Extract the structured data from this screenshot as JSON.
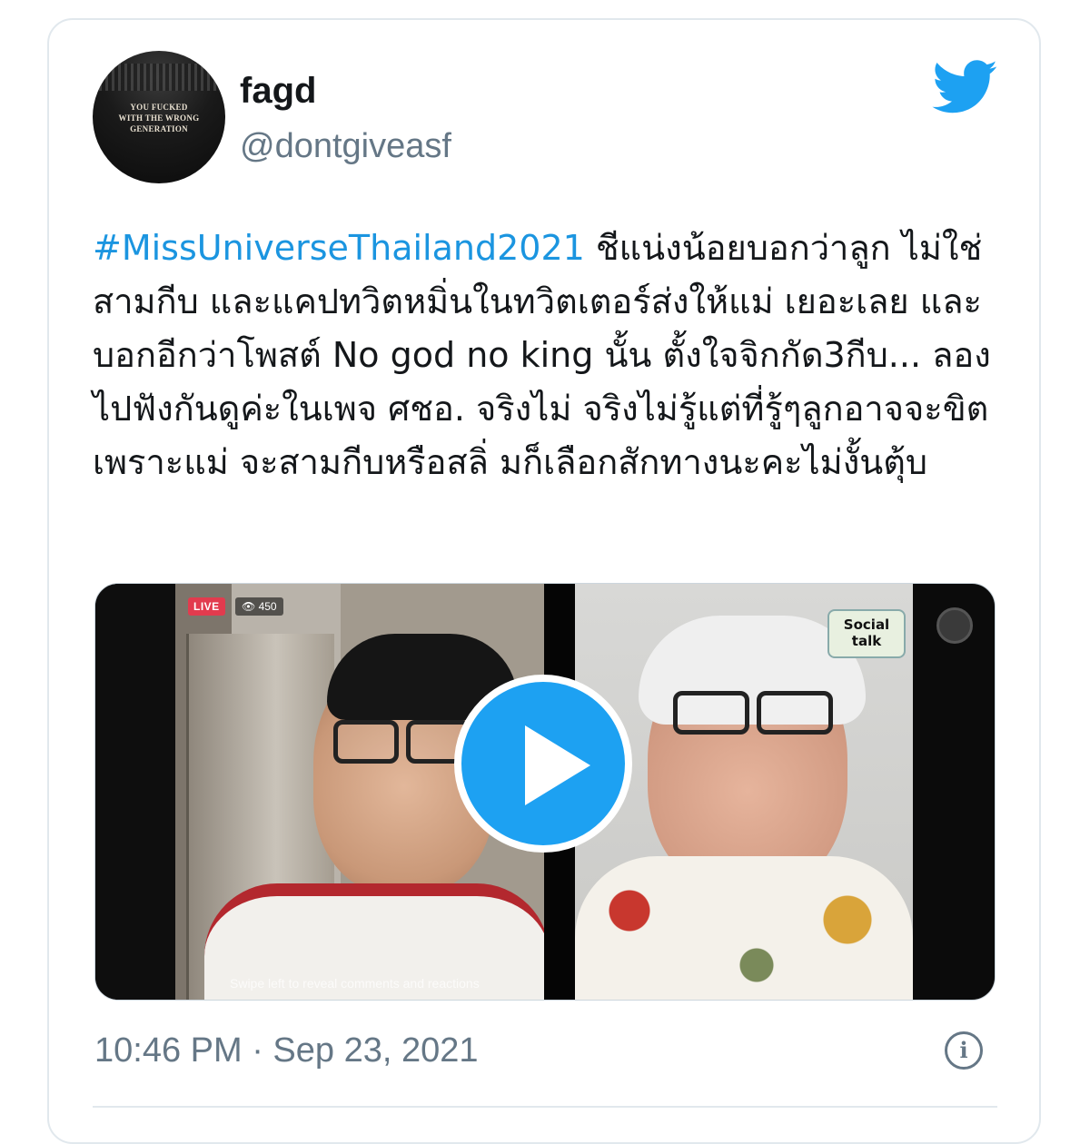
{
  "author": {
    "display_name": "fagd",
    "handle": "@dontgiveasf",
    "avatar_text": "YOU FUCKED\nWITH THE WRONG\nGENERATION"
  },
  "tweet": {
    "hashtag": "#MissUniverseThailand2021",
    "body": " ชีแน่งน้อยบอกว่าลูก ไม่ใช่สามกีบ และแคปทวิตหมิ่นในทวิตเตอร์ส่งให้แม่ เยอะเลย และบอกอีกว่าโพสต์ No god no king นั้น ตั้งใจจิกกัด3กีบ... ลองไปฟังกันดูค่ะในเพจ ศชอ. จริงไม่ จริงไม่รู้แต่ที่รู้ๆลูกอาจจะขิตเพราะแม่ จะสามกีบหรือสลิ่ มก็เลือกสักทางนะคะไม่งั้นตุ้บ"
  },
  "media": {
    "live_label": "LIVE",
    "viewers_count": "👁 450",
    "social_logo_text": "Social talk",
    "overlay_caption": "Swipe left to reveal comments and reactions"
  },
  "footer": {
    "timestamp": "10:46 PM · Sep 23, 2021",
    "info_icon_glyph": "i"
  },
  "icons": {
    "twitter_logo": "twitter-bird-icon",
    "play": "play-icon",
    "info": "info-icon"
  },
  "colors": {
    "accent": "#1da1f2",
    "hashtag": "#1b95e0",
    "text": "#14171a",
    "secondary_text": "#657786",
    "border": "#e1e8ed"
  }
}
